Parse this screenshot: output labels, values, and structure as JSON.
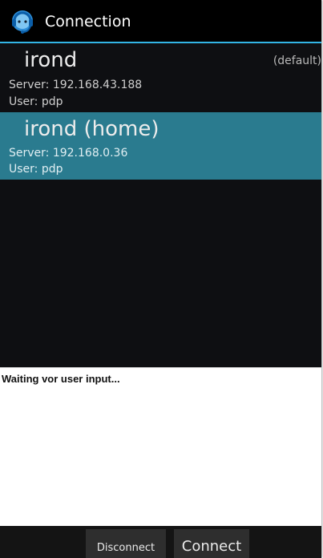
{
  "actionbar": {
    "title": "Connection",
    "icon": "headset-app-icon"
  },
  "connections": [
    {
      "name": "irond",
      "badge": "(default)",
      "server": "Server:  192.168.43.188",
      "user": "User:  pdp",
      "selected": false
    },
    {
      "name": "irond (home)",
      "badge": "",
      "server": "Server:  192.168.0.36",
      "user": "User:  pdp",
      "selected": true
    }
  ],
  "log": {
    "text": "Waiting vor user input..."
  },
  "buttons": {
    "disconnect": "Disconnect",
    "connect": "Connect"
  },
  "colors": {
    "accent": "#33b5e5",
    "selected": "#2a7b8f",
    "background": "#0e0f12"
  }
}
